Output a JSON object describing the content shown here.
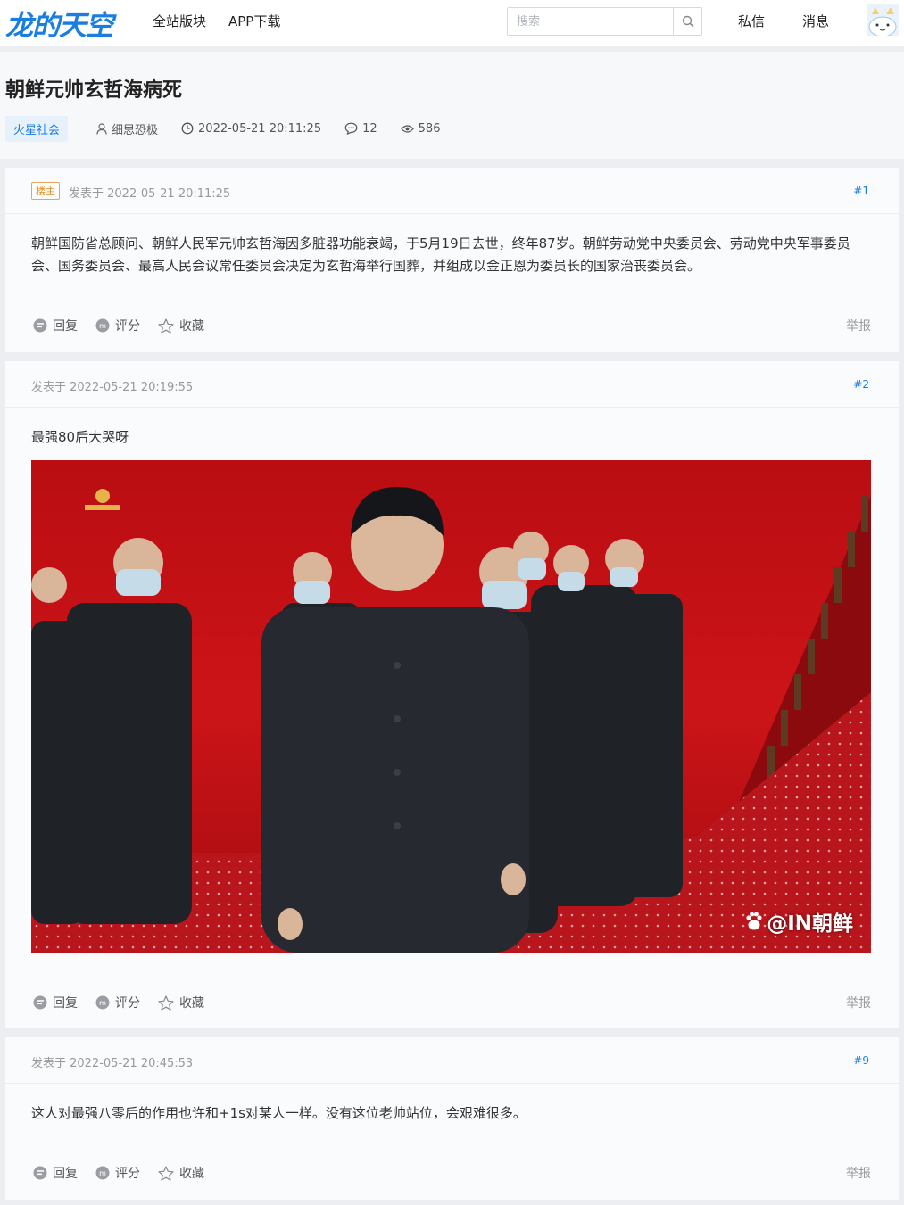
{
  "header": {
    "logo": "龙的天空",
    "nav": [
      "全站版块",
      "APP下载"
    ],
    "search_placeholder": "搜索",
    "messages": "私信",
    "notifications": "消息"
  },
  "thread": {
    "title": "朝鲜元帅玄哲海病死",
    "tag": "火星社会",
    "author": "细思恐极",
    "datetime": "2022-05-21 20:11:25",
    "replies": "12",
    "views": "586"
  },
  "actions": {
    "reply": "回复",
    "rate": "评分",
    "favorite": "收藏",
    "report": "举报"
  },
  "posts": [
    {
      "badge": "楼主",
      "date": "发表于 2022-05-21 20:11:25",
      "floor": "#1",
      "content": "朝鲜国防省总顾问、朝鲜人民军元帅玄哲海因多脏器功能衰竭，于5月19日去世，终年87岁。朝鲜劳动党中央委员会、劳动党中央军事委员会、国务委员会、最高人民会议常任委员会决定为玄哲海举行国葬，并组成以金正恩为委员长的国家治丧委员会。"
    },
    {
      "date": "发表于 2022-05-21 20:19:55",
      "floor": "#2",
      "content": "最强80后大哭呀",
      "image_watermark": "@IN朝鲜"
    },
    {
      "date": "发表于 2022-05-21 20:45:53",
      "floor": "#9",
      "content": "这人对最强八零后的作用也许和+1s对某人一样。没有这位老帅站位，会艰难很多。"
    }
  ],
  "colors": {
    "accent": "#1a7ee0",
    "op_badge": "#e48a1e",
    "background": "#eceef1"
  }
}
